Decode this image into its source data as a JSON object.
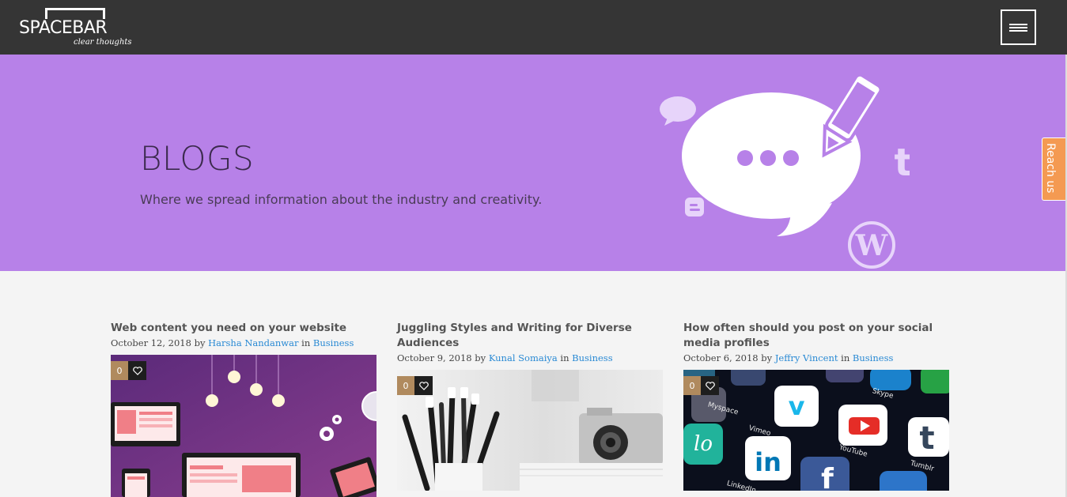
{
  "brand": {
    "name": "SPACEBAR",
    "tagline": "clear thoughts"
  },
  "header": {
    "menu_icon": "hamburger-icon"
  },
  "hero": {
    "title": "BLOGS",
    "subtitle": "Where we spread information about the industry and creativity.",
    "background_color": "#b781e8",
    "icons": [
      "speech-bubble-icon",
      "pencil-icon",
      "tumblr-icon",
      "blogger-icon",
      "wordpress-icon"
    ]
  },
  "reach_tab": {
    "label": "Reach us",
    "color": "#f49a52"
  },
  "posts": [
    {
      "title": "Web content you need on your website",
      "date": "October 12, 2018",
      "by": "by",
      "author": "Harsha Nandanwar",
      "in": "in",
      "category": "Business",
      "likes": "0",
      "image": "devices-illustration"
    },
    {
      "title": "Juggling Styles and Writing for Diverse Audiences",
      "date": "October 9, 2018",
      "by": "by",
      "author": "Kunal Somaiya",
      "in": "in",
      "category": "Business",
      "likes": "0",
      "image": "pencils-and-camera-photo"
    },
    {
      "title": "How often should you post on your social media profiles",
      "date": "October 6, 2018",
      "by": "by",
      "author": "Jeffry Vincent",
      "in": "in",
      "category": "Business",
      "likes": "0",
      "image": "social-app-icons-photo",
      "app_labels": [
        "Vimeo",
        "YouTube",
        "Tumblr",
        "LinkedIn",
        "Myspace",
        "Skype"
      ]
    }
  ]
}
